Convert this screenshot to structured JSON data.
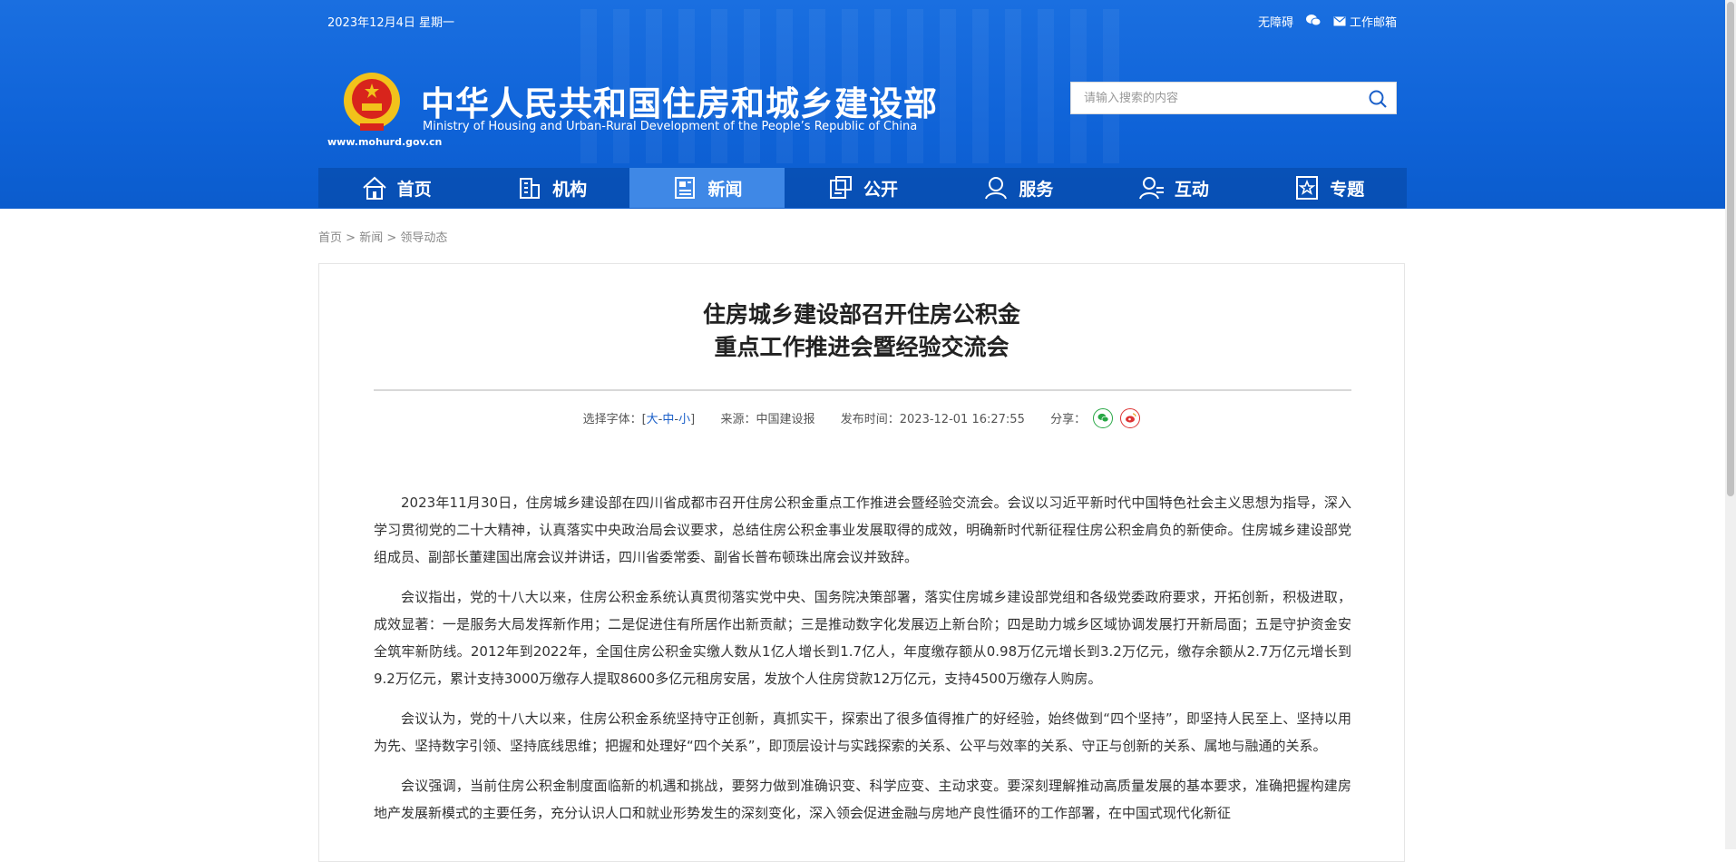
{
  "header": {
    "date": "2023年12月4日 星期一",
    "accessibility_label": "无障碍",
    "email_label": "工作邮箱",
    "site_title": "中华人民共和国住房和城乡建设部",
    "site_subtitle": "Ministry of Housing and Urban-Rural Development of the People’s Republic of China",
    "site_url": "www.mohurd.gov.cn"
  },
  "search": {
    "placeholder": "请输入搜索的内容"
  },
  "nav": {
    "items": [
      {
        "label": "首页",
        "icon": "home-icon"
      },
      {
        "label": "机构",
        "icon": "building-icon"
      },
      {
        "label": "新闻",
        "icon": "news-icon",
        "active": true
      },
      {
        "label": "公开",
        "icon": "disclosure-icon"
      },
      {
        "label": "服务",
        "icon": "service-icon"
      },
      {
        "label": "互动",
        "icon": "interaction-icon"
      },
      {
        "label": "专题",
        "icon": "star-icon"
      }
    ]
  },
  "breadcrumb": {
    "home": "首页",
    "news": "新闻",
    "current": "领导动态",
    "sep": ">"
  },
  "article": {
    "title_line1": "住房城乡建设部召开住房公积金",
    "title_line2": "重点工作推进会暨经验交流会",
    "font_label": "选择字体：[",
    "font_large": "大",
    "font_medium": "中",
    "font_small": "小",
    "font_dash": "-",
    "font_close": "]",
    "source": "来源：中国建设报",
    "publish_time": "发布时间：2023-12-01 16:27:55",
    "share_label": "分享：",
    "paragraphs": [
      "2023年11月30日，住房城乡建设部在四川省成都市召开住房公积金重点工作推进会暨经验交流会。会议以习近平新时代中国特色社会主义思想为指导，深入学习贯彻党的二十大精神，认真落实中央政治局会议要求，总结住房公积金事业发展取得的成效，明确新时代新征程住房公积金肩负的新使命。住房城乡建设部党组成员、副部长董建国出席会议并讲话，四川省委常委、副省长普布顿珠出席会议并致辞。",
      "会议指出，党的十八大以来，住房公积金系统认真贯彻落实党中央、国务院决策部署，落实住房城乡建设部党组和各级党委政府要求，开拓创新，积极进取，成效显著：一是服务大局发挥新作用；二是促进住有所居作出新贡献；三是推动数字化发展迈上新台阶；四是助力城乡区域协调发展打开新局面；五是守护资金安全筑牢新防线。2012年到2022年，全国住房公积金实缴人数从1亿人增长到1.7亿人，年度缴存额从0.98万亿元增长到3.2万亿元，缴存余额从2.7万亿元增长到9.2万亿元，累计支持3000万缴存人提取8600多亿元租房安居，发放个人住房贷款12万亿元，支持4500万缴存人购房。",
      "会议认为，党的十八大以来，住房公积金系统坚持守正创新，真抓实干，探索出了很多值得推广的好经验，始终做到“四个坚持”，即坚持人民至上、坚持以用为先、坚持数字引领、坚持底线思维；把握和处理好“四个关系”，即顶层设计与实践探索的关系、公平与效率的关系、守正与创新的关系、属地与融通的关系。",
      "会议强调，当前住房公积金制度面临新的机遇和挑战，要努力做到准确识变、科学应变、主动求变。要深刻理解推动高质量发展的基本要求，准确把握构建房地产发展新模式的主要任务，充分认识人口和就业形势发生的深刻变化，深入领会促进金融与房地产良性循环的工作部署，在中国式现代化新征"
    ]
  }
}
